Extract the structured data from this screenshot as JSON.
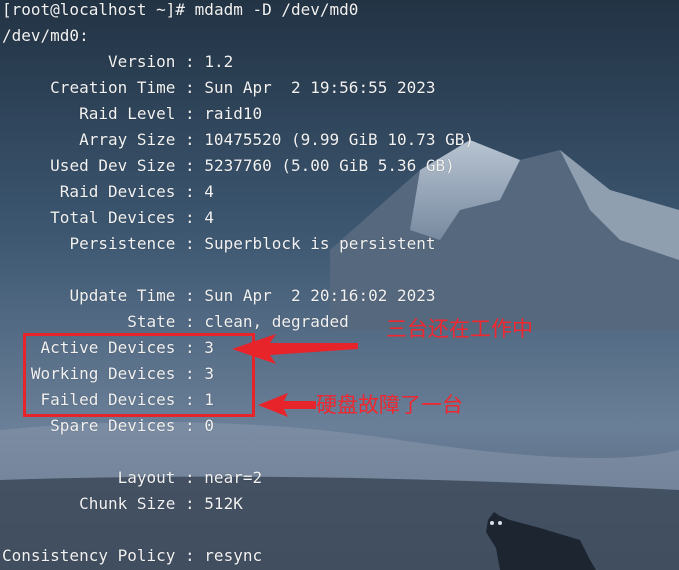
{
  "terminal": {
    "prompt": "[root@localhost ~]#",
    "command": "mdadm -D /dev/md0",
    "device_header": "/dev/md0:",
    "fields": {
      "version": {
        "label": "Version",
        "value": "1.2"
      },
      "creation_time": {
        "label": "Creation Time",
        "value": "Sun Apr  2 19:56:55 2023"
      },
      "raid_level": {
        "label": "Raid Level",
        "value": "raid10"
      },
      "array_size": {
        "label": "Array Size",
        "value": "10475520 (9.99 GiB 10.73 GB)"
      },
      "used_dev_size": {
        "label": "Used Dev Size",
        "value": "5237760 (5.00 GiB 5.36 GB)"
      },
      "raid_devices": {
        "label": "Raid Devices",
        "value": "4"
      },
      "total_devices": {
        "label": "Total Devices",
        "value": "4"
      },
      "persistence": {
        "label": "Persistence",
        "value": "Superblock is persistent"
      },
      "update_time": {
        "label": "Update Time",
        "value": "Sun Apr  2 20:16:02 2023"
      },
      "state": {
        "label": "State",
        "value": "clean, degraded"
      },
      "active_devices": {
        "label": "Active Devices",
        "value": "3"
      },
      "working_devices": {
        "label": "Working Devices",
        "value": "3"
      },
      "failed_devices": {
        "label": "Failed Devices",
        "value": "1"
      },
      "spare_devices": {
        "label": "Spare Devices",
        "value": "0"
      },
      "layout": {
        "label": "Layout",
        "value": "near=2"
      },
      "chunk_size": {
        "label": "Chunk Size",
        "value": "512K"
      },
      "consistency_policy": {
        "label": "Consistency Policy",
        "value": "resync"
      }
    }
  },
  "annotations": {
    "working_note": "三台还在工作中",
    "failed_note": "硬盘故障了一台",
    "color": "#e8242b"
  }
}
